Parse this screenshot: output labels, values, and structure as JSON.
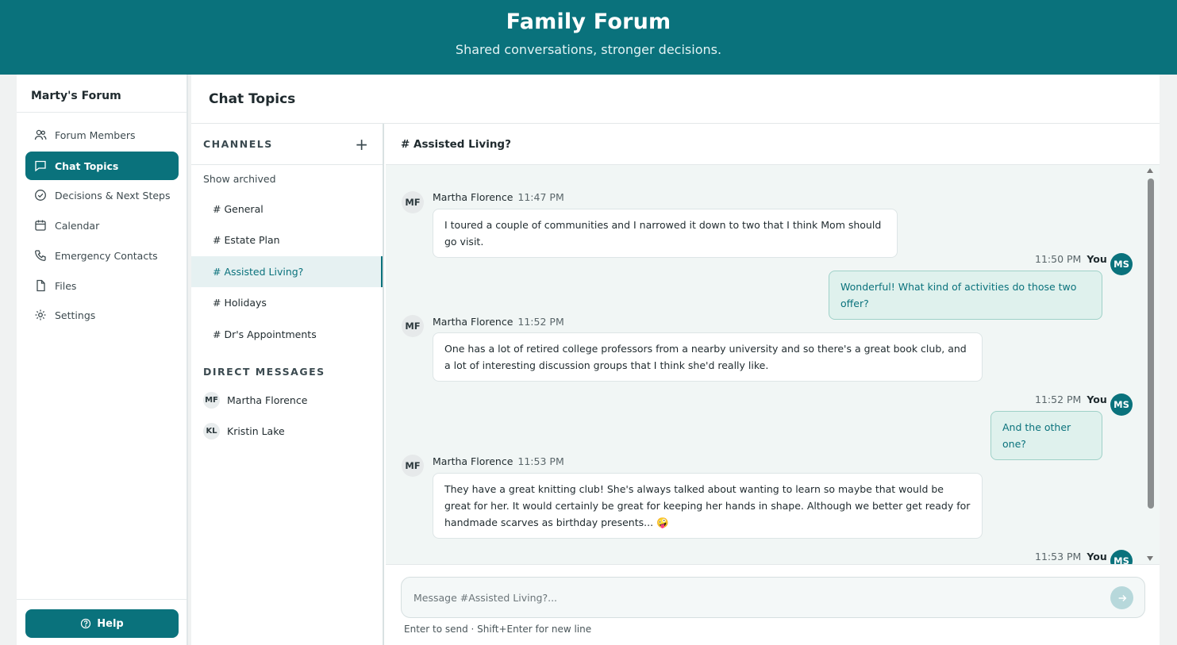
{
  "header": {
    "title": "Family Forum",
    "subtitle": "Shared conversations, stronger decisions."
  },
  "sidebar": {
    "title": "Marty's Forum",
    "items": [
      {
        "label": "Forum Members",
        "icon": "users-icon"
      },
      {
        "label": "Chat Topics",
        "icon": "chat-bubble-icon",
        "active": true
      },
      {
        "label": "Decisions & Next Steps",
        "icon": "check-circle-icon"
      },
      {
        "label": "Calendar",
        "icon": "calendar-icon"
      },
      {
        "label": "Emergency Contacts",
        "icon": "phone-icon"
      },
      {
        "label": "Files",
        "icon": "file-icon"
      },
      {
        "label": "Settings",
        "icon": "gear-icon"
      }
    ],
    "help_label": "Help"
  },
  "main": {
    "title": "Chat Topics"
  },
  "channels": {
    "heading": "CHANNELS",
    "add_icon": "+",
    "show_archived": "Show archived",
    "items": [
      "# General",
      "# Estate Plan",
      "# Assisted Living?",
      "# Holidays",
      "# Dr's Appointments"
    ],
    "active": "# Assisted Living?",
    "dm_heading": "DIRECT MESSAGES",
    "dms": [
      {
        "initials": "MF",
        "name": "Martha Florence"
      },
      {
        "initials": "KL",
        "name": "Kristin Lake"
      }
    ]
  },
  "chat": {
    "channel": "# Assisted Living?",
    "messages": [
      {
        "initials": "MF",
        "author": "Martha Florence",
        "time": "11:47 PM",
        "text": "I toured a couple of communities and I narrowed it down to two that I think Mom should go visit.",
        "mine": false
      },
      {
        "initials": "MS",
        "author": "You",
        "time": "11:50 PM",
        "text": "Wonderful! What kind of activities do those two offer?",
        "mine": true
      },
      {
        "initials": "MF",
        "author": "Martha Florence",
        "time": "11:52 PM",
        "text": "One has a lot of retired college professors from a nearby university and so there's a great book club, and a lot of interesting discussion groups that I think she'd really like.",
        "mine": false
      },
      {
        "initials": "MS",
        "author": "You",
        "time": "11:52 PM",
        "text": "And the other one?",
        "mine": true
      },
      {
        "initials": "MF",
        "author": "Martha Florence",
        "time": "11:53 PM",
        "text": "They have a great knitting club! She's always talked about wanting to learn so maybe that would be great for her. It would certainly be great for keeping her hands in shape. Although we better get ready for handmade scarves as birthday presents... 🤪",
        "mine": false
      },
      {
        "initials": "MS",
        "author": "You",
        "time": "11:53 PM",
        "text": "",
        "mine": true
      }
    ],
    "input_placeholder": "Message #Assisted Living?...",
    "hint": "Enter to send · Shift+Enter for new line"
  },
  "colors": {
    "brand": "#0a727c",
    "outgoing_bubble": "#dff1ed",
    "active_channel_bg": "#e6f1f2"
  }
}
